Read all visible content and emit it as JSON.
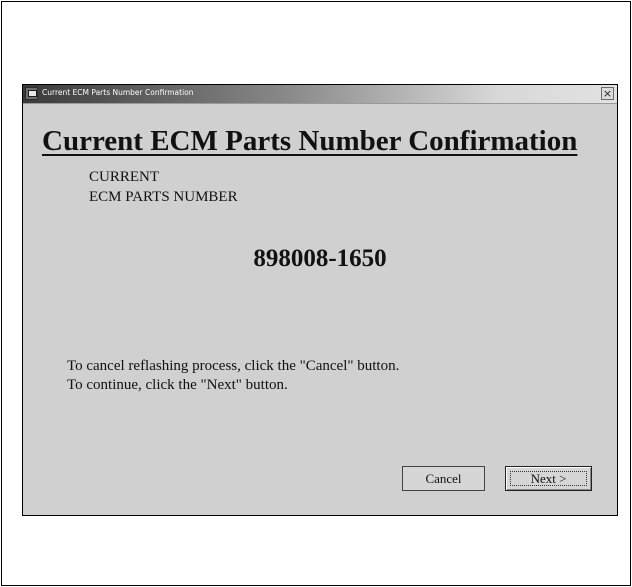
{
  "window": {
    "title": "Current ECM Parts Number Confirmation",
    "close_glyph": "×"
  },
  "dialog": {
    "heading": "Current ECM Parts Number Confirmation",
    "label_line1": "CURRENT",
    "label_line2": "ECM PARTS NUMBER",
    "parts_number": "898008-1650",
    "instruction_line1": "To cancel reflashing process, click the \"Cancel\" button.",
    "instruction_line2": "To continue, click the \"Next\" button."
  },
  "buttons": {
    "cancel_label": "Cancel",
    "next_label": "Next >"
  },
  "icons": {
    "app_icon": "app-icon",
    "close_icon": "close-icon"
  },
  "colors": {
    "dialog_background": "#d0d0d0",
    "titlebar_start": "#3a3a3a",
    "titlebar_end": "#e2e2e2",
    "text": "#111111"
  }
}
